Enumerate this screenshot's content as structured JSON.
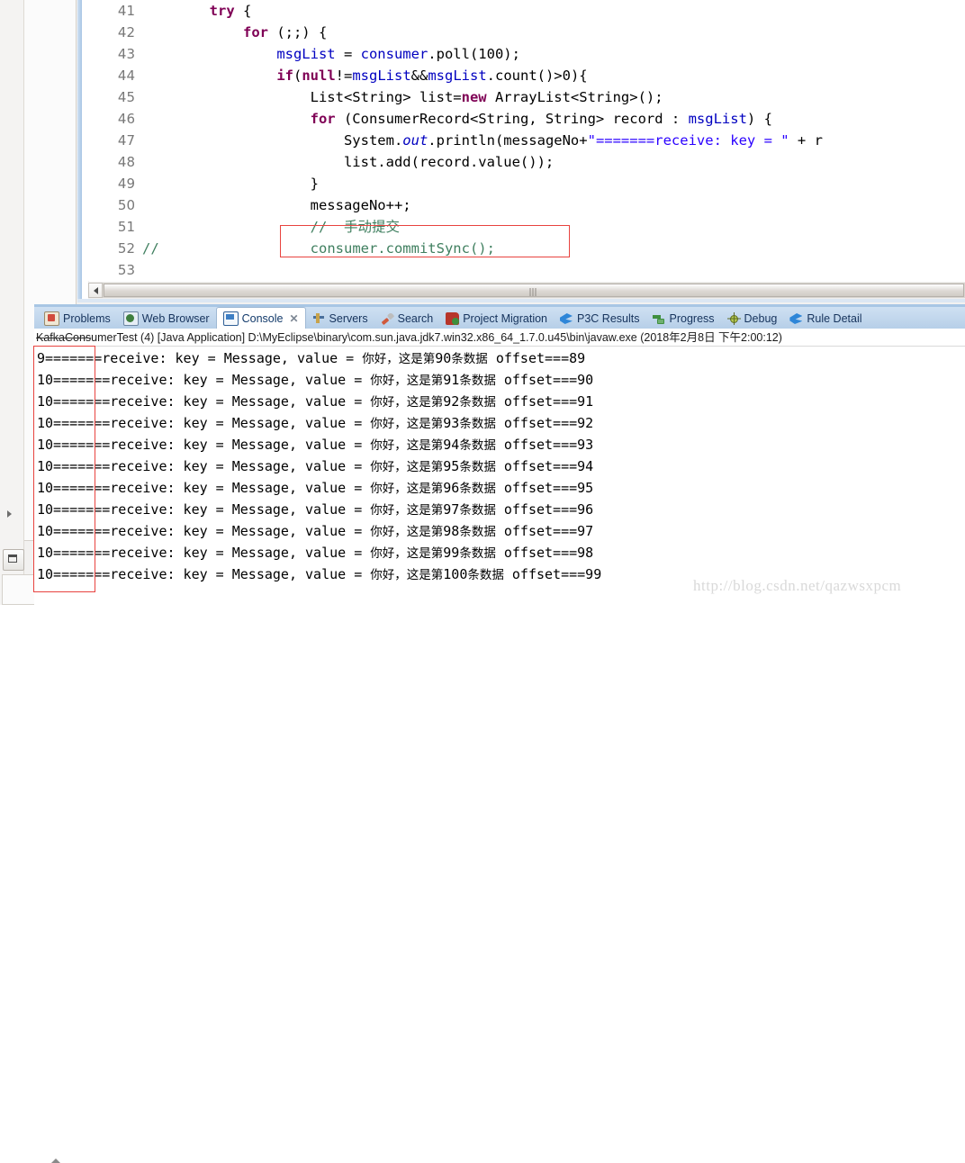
{
  "editor": {
    "name": "java-source-editor",
    "first_line_number": 41,
    "lines": [
      {
        "no": "41",
        "segments": [
          {
            "t": "        ",
            "c": "plain"
          },
          {
            "t": "try",
            "c": "kw"
          },
          {
            "t": " {",
            "c": "plain"
          }
        ]
      },
      {
        "no": "42",
        "segments": [
          {
            "t": "            ",
            "c": "plain"
          },
          {
            "t": "for",
            "c": "kw"
          },
          {
            "t": " (;;) {",
            "c": "plain"
          }
        ]
      },
      {
        "no": "43",
        "segments": [
          {
            "t": "                ",
            "c": "plain"
          },
          {
            "t": "msgList",
            "c": "fld"
          },
          {
            "t": " = ",
            "c": "plain"
          },
          {
            "t": "consumer",
            "c": "fld"
          },
          {
            "t": ".poll(100);",
            "c": "plain"
          }
        ]
      },
      {
        "no": "44",
        "segments": [
          {
            "t": "                ",
            "c": "plain"
          },
          {
            "t": "if",
            "c": "kw"
          },
          {
            "t": "(",
            "c": "plain"
          },
          {
            "t": "null",
            "c": "kw"
          },
          {
            "t": "!=",
            "c": "plain"
          },
          {
            "t": "msgList",
            "c": "fld"
          },
          {
            "t": "&&",
            "c": "plain"
          },
          {
            "t": "msgList",
            "c": "fld"
          },
          {
            "t": ".count()>0){",
            "c": "plain"
          }
        ]
      },
      {
        "no": "45",
        "segments": [
          {
            "t": "                    List<String> list=",
            "c": "plain"
          },
          {
            "t": "new",
            "c": "kw"
          },
          {
            "t": " ArrayList<String>();",
            "c": "plain"
          }
        ]
      },
      {
        "no": "46",
        "segments": [
          {
            "t": "                    ",
            "c": "plain"
          },
          {
            "t": "for",
            "c": "kw"
          },
          {
            "t": " (ConsumerRecord<String, String> record : ",
            "c": "plain"
          },
          {
            "t": "msgList",
            "c": "fld"
          },
          {
            "t": ") {",
            "c": "plain"
          }
        ]
      },
      {
        "no": "47",
        "segments": [
          {
            "t": "                        System.",
            "c": "plain"
          },
          {
            "t": "out",
            "c": "stat"
          },
          {
            "t": ".println(messageNo+",
            "c": "plain"
          },
          {
            "t": "\"=======receive: key = \"",
            "c": "str"
          },
          {
            "t": " + r",
            "c": "plain"
          }
        ]
      },
      {
        "no": "48",
        "segments": [
          {
            "t": "                        list.add(record.value());",
            "c": "plain"
          }
        ]
      },
      {
        "no": "49",
        "segments": [
          {
            "t": "                    }",
            "c": "plain"
          }
        ]
      },
      {
        "no": "50",
        "segments": [
          {
            "t": "                    messageNo++;",
            "c": "plain"
          }
        ]
      },
      {
        "no": "51",
        "segments": [
          {
            "t": "                    ",
            "c": "plain"
          },
          {
            "t": "//  手动提交",
            "c": "cmt"
          }
        ]
      },
      {
        "no": "52",
        "segments": [
          {
            "t": "//",
            "c": "cmt"
          },
          {
            "t": "                  ",
            "c": "plain"
          },
          {
            "t": "consumer.commitSync();",
            "c": "cmt"
          }
        ]
      },
      {
        "no": "53",
        "segments": [
          {
            "t": "",
            "c": "plain"
          }
        ]
      }
    ],
    "scrollbar": {
      "left_arrow": "scroll-left-arrow",
      "grip": "scroll-grip"
    }
  },
  "console_view": {
    "tabs": [
      {
        "label": "Problems",
        "icon": "problems-icon",
        "active": false,
        "closable": false
      },
      {
        "label": "Web Browser",
        "icon": "web-browser-icon",
        "active": false,
        "closable": false
      },
      {
        "label": "Console",
        "icon": "console-icon",
        "active": true,
        "closable": true,
        "close_label": "✕"
      },
      {
        "label": "Servers",
        "icon": "servers-icon",
        "active": false,
        "closable": false
      },
      {
        "label": "Search",
        "icon": "search-icon",
        "active": false,
        "closable": false
      },
      {
        "label": "Project Migration",
        "icon": "project-migration-icon",
        "active": false,
        "closable": false
      },
      {
        "label": "P3C Results",
        "icon": "p3c-results-icon",
        "active": false,
        "closable": false
      },
      {
        "label": "Progress",
        "icon": "progress-icon",
        "active": false,
        "closable": false
      },
      {
        "label": "Debug",
        "icon": "debug-icon",
        "active": false,
        "closable": false
      },
      {
        "label": "Rule Detail",
        "icon": "rule-detail-icon",
        "active": false,
        "closable": false
      }
    ],
    "process_header": {
      "struck_part": "KafkaCons",
      "rest": "umerTest (4) [Java Application] D:\\MyEclipse\\binary\\com.sun.java.jdk7.win32.x86_64_1.7.0.u45\\bin\\javaw.exe (2018年2月8日 下午2:00:12)"
    },
    "output_lines": [
      "9=======receive: key = Message, value = 你好，这是第90条数据 offset===89",
      "10=======receive: key = Message, value = 你好，这是第91条数据 offset===90",
      "10=======receive: key = Message, value = 你好，这是第92条数据 offset===91",
      "10=======receive: key = Message, value = 你好，这是第93条数据 offset===92",
      "10=======receive: key = Message, value = 你好，这是第94条数据 offset===93",
      "10=======receive: key = Message, value = 你好，这是第95条数据 offset===94",
      "10=======receive: key = Message, value = 你好，这是第96条数据 offset===95",
      "10=======receive: key = Message, value = 你好，这是第97条数据 offset===96",
      "10=======receive: key = Message, value = 你好，这是第98条数据 offset===97",
      "10=======receive: key = Message, value = 你好，这是第99条数据 offset===98",
      "10=======receive: key = Message, value = 你好，这是第100条数据 offset===99"
    ]
  },
  "annotations": {
    "code_box_color": "#e8433f",
    "console_box_color": "#e8433f"
  },
  "watermark": {
    "text": "http://blog.csdn.net/qazwsxpcm"
  }
}
